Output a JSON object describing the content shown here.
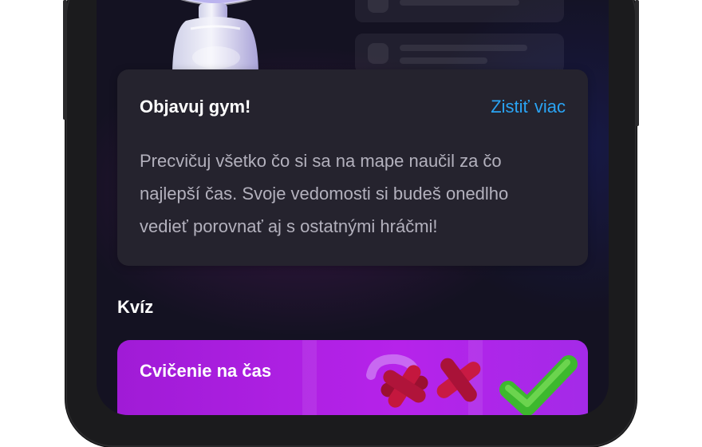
{
  "info_card": {
    "title": "Objavuj gym!",
    "link_label": "Zistiť viac",
    "line1": "Precvičuj všetko čo si sa na mape naučil za čo",
    "line2": "najlepší čas. Svoje vedomosti si budeš onedlho",
    "line3": "vedieť porovnať aj s ostatnými hráčmi!"
  },
  "quiz_section": {
    "title": "Kvíz",
    "card_title": "Cvičenie na čas"
  },
  "colors": {
    "link": "#2aa4f4",
    "card_bg": "#25232e",
    "quiz_card": "#b623ea"
  }
}
